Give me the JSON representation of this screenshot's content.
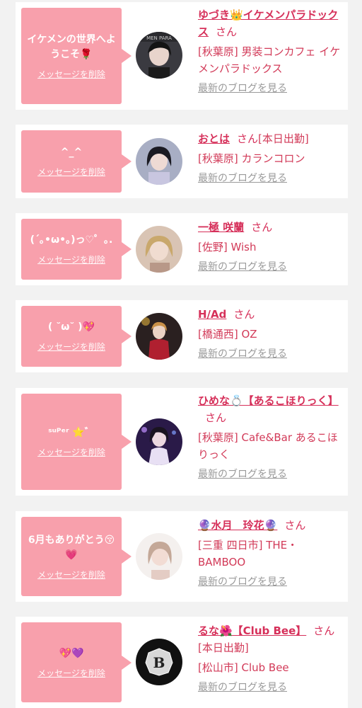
{
  "theme": {
    "pink": "#f8a0ac",
    "accent": "#d6305a",
    "muted": "#9a9a9a",
    "background": "#f2f2f2"
  },
  "items": [
    {
      "message": "イケメンの世界へようこそ🌹",
      "delete_label": "メッセージを削除",
      "name": "ゆづき👑イケメンパラドックス",
      "honorific": "さん",
      "status": "",
      "shop": "[秋葉原] 男装コンカフェ イケメンパラドックス",
      "blog_link": "最新のブログを見る",
      "avatar_icon": "avatar-photo-man-black-hair"
    },
    {
      "message": "^_^",
      "delete_label": "メッセージを削除",
      "name": "おとは",
      "honorific": "さん",
      "status": "[本日出勤]",
      "shop": "[秋葉原] カランコロン",
      "blog_link": "最新のブログを見る",
      "avatar_icon": "avatar-photo-girl-black-hair"
    },
    {
      "message": "(´｡•ω•｡)っ♡゜｡.",
      "delete_label": "メッセージを削除",
      "name": "一極 咲蘭",
      "honorific": "さん",
      "status": "",
      "shop": "[佐野] Wish",
      "blog_link": "最新のブログを見る",
      "avatar_icon": "avatar-photo-blonde-woman"
    },
    {
      "message": "( ˘ω˘ )💖",
      "delete_label": "メッセージを削除",
      "name": "H/Ad",
      "honorific": "さん",
      "status": "",
      "shop": "[橋通西] OZ",
      "blog_link": "最新のブログを見る",
      "avatar_icon": "avatar-photo-red-jacket"
    },
    {
      "message": "ˢᵘᴾᵉʳ ⭐゛",
      "delete_label": "メッセージを削除",
      "name": "ひめな💍【あるこほりっく】",
      "honorific": "さん",
      "status": "",
      "shop": "[秋葉原] Cafe&Bar あるこほりっく",
      "blog_link": "最新のブログを見る",
      "avatar_icon": "avatar-photo-purple-stage"
    },
    {
      "message": "6月もありがとう😚💗",
      "delete_label": "メッセージを削除",
      "name": "🔮水月　玲花🔮",
      "honorific": "さん",
      "status": "",
      "shop": "[三重 四日市] THE・BAMBOO",
      "blog_link": "最新のブログを見る",
      "avatar_icon": "avatar-photo-light-hair-woman"
    },
    {
      "message": "💖💜",
      "delete_label": "メッセージを削除",
      "name": "るな🌺【Club Bee】",
      "honorific": "さん",
      "status": "[本日出勤]",
      "shop": "[松山市] Club Bee",
      "blog_link": "最新のブログを見る",
      "avatar_icon": "avatar-logo-executive-club-B",
      "avatar_logo_letter": "B"
    }
  ]
}
